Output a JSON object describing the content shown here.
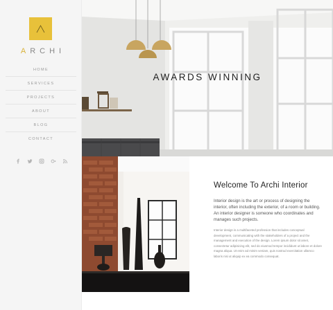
{
  "brand": {
    "name_first": "A",
    "name_rest": "RCHI"
  },
  "nav": {
    "items": [
      {
        "label": "HOME"
      },
      {
        "label": "SERVICES"
      },
      {
        "label": "PROJECTS"
      },
      {
        "label": "ABOUT"
      },
      {
        "label": "BLOG"
      },
      {
        "label": "CONTACT"
      }
    ]
  },
  "social": [
    "facebook-icon",
    "twitter-icon",
    "instagram-icon",
    "google-plus-icon",
    "rss-icon"
  ],
  "hero": {
    "title": "AWARDS WINNING"
  },
  "content": {
    "title": "Welcome To Archi Interior",
    "lead": "Interior design is the art or process of designing the interior, often including the exterior, of a room or building. An interior designer is someone who coordinates and manages such projects.",
    "body": "Interior design is a multifaceted profession that includes conceptual development, communicating with the stakeholders of a project and the management and execution of the design. Lorem ipsum dolor sit amet, consectetur adipisicing elit, sed do eiusmod tempor incididunt ut labore et dolore magna aliqua. Ut enim ad minim veniam, quis nostrud exercitation ullamco laboris nisi ut aliquip ex ea commodo consequat."
  },
  "colors": {
    "accent": "#e8c13a",
    "sidebar_bg": "#f5f5f5",
    "text_dark": "#222222"
  }
}
